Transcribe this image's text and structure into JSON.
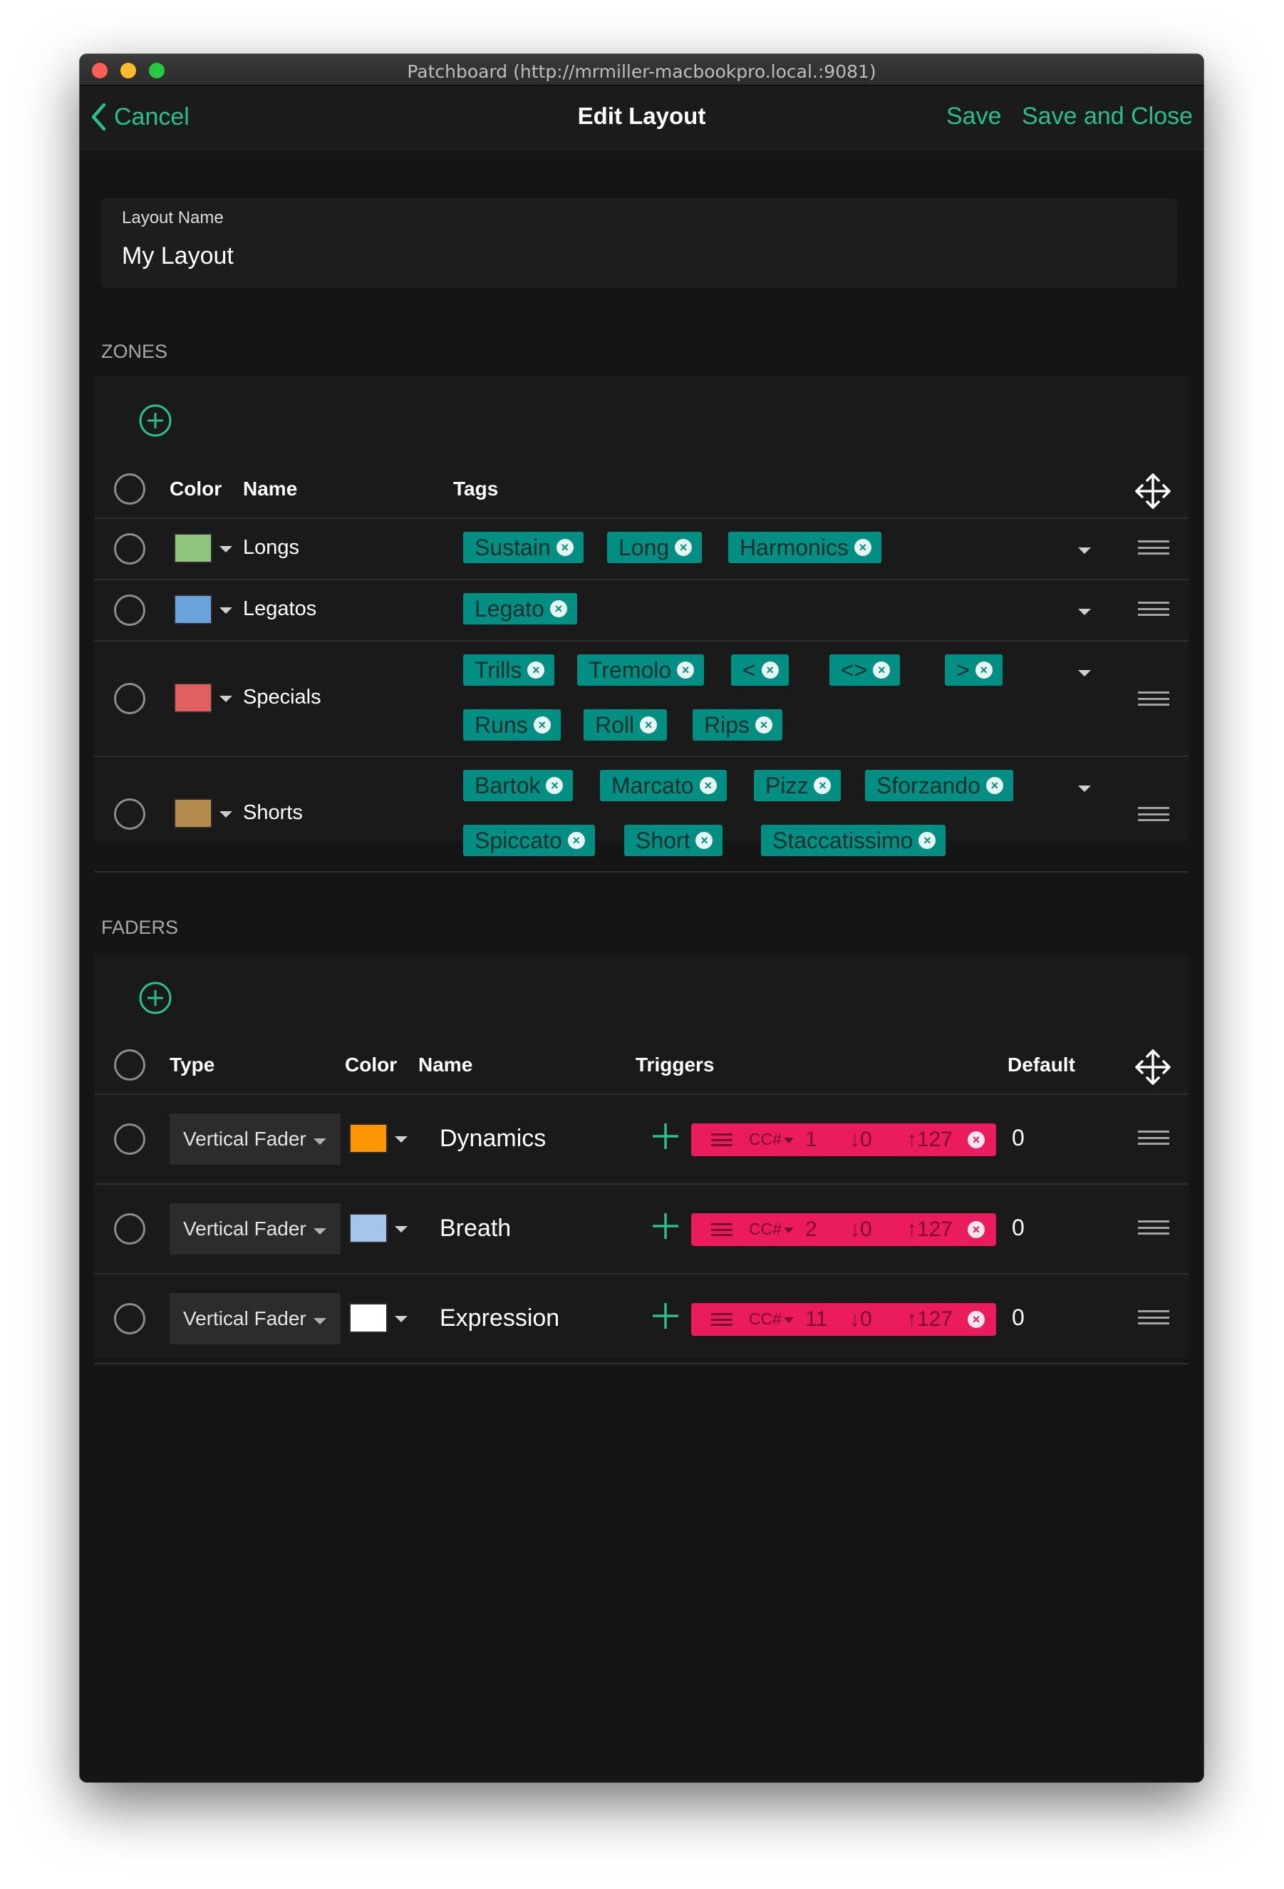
{
  "window": {
    "title": "Patchboard (http://mrmiller-macbookpro.local.:9081)"
  },
  "nav": {
    "cancel": "Cancel",
    "title": "Edit Layout",
    "save": "Save",
    "save_and_close": "Save and Close"
  },
  "layout_name": {
    "label": "Layout Name",
    "value": "My Layout"
  },
  "zones": {
    "section_label": "ZONES",
    "headers": {
      "color": "Color",
      "name": "Name",
      "tags": "Tags"
    },
    "rows": [
      {
        "name": "Longs",
        "color": "#8fc57e",
        "tags": [
          "Sustain",
          "Long",
          "Harmonics"
        ]
      },
      {
        "name": "Legatos",
        "color": "#6aa3db",
        "tags": [
          "Legato"
        ]
      },
      {
        "name": "Specials",
        "color": "#e06060",
        "tags": [
          "Trills",
          "Tremolo",
          "<",
          "<>",
          ">",
          "Runs",
          "Roll",
          "Rips"
        ]
      },
      {
        "name": "Shorts",
        "color": "#b48a4e",
        "tags": [
          "Bartok",
          "Marcato",
          "Pizz",
          "Sforzando",
          "Spiccato",
          "Short",
          "Staccatissimo"
        ]
      }
    ]
  },
  "faders": {
    "section_label": "FADERS",
    "headers": {
      "type": "Type",
      "color": "Color",
      "name": "Name",
      "triggers": "Triggers",
      "default": "Default"
    },
    "rows": [
      {
        "type": "Vertical Fader",
        "color": "#ff9500",
        "name": "Dynamics",
        "trigger": {
          "kind": "CC#",
          "number": "1",
          "low": "↓0",
          "high": "↑127"
        },
        "default": "0"
      },
      {
        "type": "Vertical Fader",
        "color": "#a4c6ea",
        "name": "Breath",
        "trigger": {
          "kind": "CC#",
          "number": "2",
          "low": "↓0",
          "high": "↑127"
        },
        "default": "0"
      },
      {
        "type": "Vertical Fader",
        "color": "#ffffff",
        "name": "Expression",
        "trigger": {
          "kind": "CC#",
          "number": "11",
          "low": "↓0",
          "high": "↑127"
        },
        "default": "0"
      }
    ]
  }
}
